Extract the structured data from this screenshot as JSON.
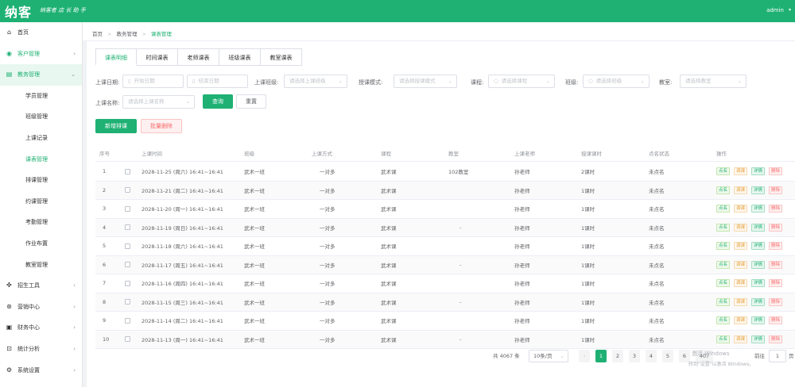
{
  "header": {
    "logo": "纳客",
    "slogan": "纳客者 店 长 助 手",
    "user": "admin",
    "user_caret": "▾"
  },
  "sidebar": {
    "items": [
      {
        "label": "首页",
        "icon": "home-icon",
        "glyph": "⌂"
      },
      {
        "label": "客户管理",
        "icon": "user-icon",
        "glyph": "◉"
      },
      {
        "label": "教务管理",
        "icon": "book-icon",
        "glyph": "▤"
      },
      {
        "label": "招生工具",
        "icon": "tool-icon",
        "glyph": "✜"
      },
      {
        "label": "营销中心",
        "icon": "gift-icon",
        "glyph": "⊛"
      },
      {
        "label": "财务中心",
        "icon": "wallet-icon",
        "glyph": "▣"
      },
      {
        "label": "统计分析",
        "icon": "chart-icon",
        "glyph": "⊡"
      },
      {
        "label": "系统设置",
        "icon": "gear-icon",
        "glyph": "⚙"
      }
    ],
    "subitems": [
      "学员管理",
      "班级管理",
      "上课记录",
      "课表管理",
      "排课管理",
      "约课管理",
      "考勤管理",
      "作业布置",
      "教室管理"
    ]
  },
  "breadcrumb": {
    "items": [
      "首页",
      "教务管理",
      "课表管理"
    ],
    "sep": ">"
  },
  "tabs": [
    "课表明细",
    "时间课表",
    "老师课表",
    "班级课表",
    "教室课表"
  ],
  "filters": {
    "date_label": "上课日期:",
    "start_placeholder": "开始日期",
    "end_placeholder": "结束日期",
    "class_label": "上课班级:",
    "class_placeholder": "请选择上课班级",
    "mode_label": "授课模式:",
    "mode_placeholder": "请选择授课模式",
    "lesson_label": "课程:",
    "lesson_placeholder": "请选择课程",
    "grade_label": "班级:",
    "grade_placeholder": "请选择班级",
    "teacher_label": "教室:",
    "teacher_placeholder": "请选择教室",
    "status_label": "上课名称:",
    "status_placeholder": "请选择上课名称",
    "search_btn": "查询",
    "reset_btn": "重置",
    "calendar_glyph": "▯",
    "search_glyph": "○",
    "caret": "⌄"
  },
  "actions": {
    "add": "新增排课",
    "delete": "批量删除"
  },
  "table": {
    "headers": [
      "序号",
      "",
      "上课时间",
      "班级",
      "上课方式",
      "课程",
      "教室",
      "上课老师",
      "授课课时",
      "点名状态",
      "操作"
    ],
    "rows": [
      [
        "1",
        "2028-11-25 (周六) 16:41~16:41",
        "武术一班",
        "一对多",
        "武术课",
        "102教室",
        "孙老师",
        "2课时",
        "未点名"
      ],
      [
        "2",
        "2028-11-21 (周二) 16:41~16:41",
        "武术一班",
        "一对多",
        "武术课",
        "",
        "孙老师",
        "1课时",
        "未点名"
      ],
      [
        "3",
        "2028-11-20 (周一) 16:41~16:41",
        "武术一班",
        "一对多",
        "武术课",
        "",
        "孙老师",
        "1课时",
        "未点名"
      ],
      [
        "4",
        "2028-11-19 (周日) 16:41~16:41",
        "武术一班",
        "一对多",
        "武术课",
        "-",
        "孙老师",
        "1课时",
        "未点名"
      ],
      [
        "5",
        "2028-11-18 (周六) 16:41~16:41",
        "武术一班",
        "一对多",
        "武术课",
        "",
        "孙老师",
        "1课时",
        "未点名"
      ],
      [
        "6",
        "2028-11-17 (周五) 16:41~16:41",
        "武术一班",
        "一对多",
        "武术课",
        "-",
        "孙老师",
        "1课时",
        "未点名"
      ],
      [
        "7",
        "2028-11-16 (周四) 16:41~16:41",
        "武术一班",
        "一对多",
        "武术课",
        "",
        "孙老师",
        "1课时",
        "未点名"
      ],
      [
        "8",
        "2028-11-15 (周三) 16:41~16:41",
        "武术一班",
        "一对多",
        "武术课",
        "-",
        "孙老师",
        "1课时",
        "未点名"
      ],
      [
        "9",
        "2028-11-14 (周二) 16:41~16:41",
        "武术一班",
        "一对多",
        "武术课",
        "",
        "孙老师",
        "1课时",
        "未点名"
      ],
      [
        "10",
        "2028-11-13 (周一) 16:41~16:41",
        "武术一班",
        "一对多",
        "武术课",
        "-",
        "孙老师",
        "1课时",
        "未点名"
      ]
    ],
    "ops": [
      "点名",
      "调课",
      "详情",
      "删除"
    ]
  },
  "pagination": {
    "total": "共 4067 条",
    "page_size": "10条/页",
    "pages": [
      "1",
      "2",
      "3",
      "4",
      "5",
      "6"
    ],
    "ellipsis": "407",
    "prev": "‹",
    "goto_label": "前往",
    "goto_value": "1",
    "goto_suffix": "页"
  },
  "watermark": {
    "line1": "激活 Windows",
    "line2": "转到\"设置\"以激活 Windows。"
  },
  "colors": {
    "brand": "#1eb173",
    "danger": "#f56c6c",
    "warning": "#e6a23c"
  }
}
